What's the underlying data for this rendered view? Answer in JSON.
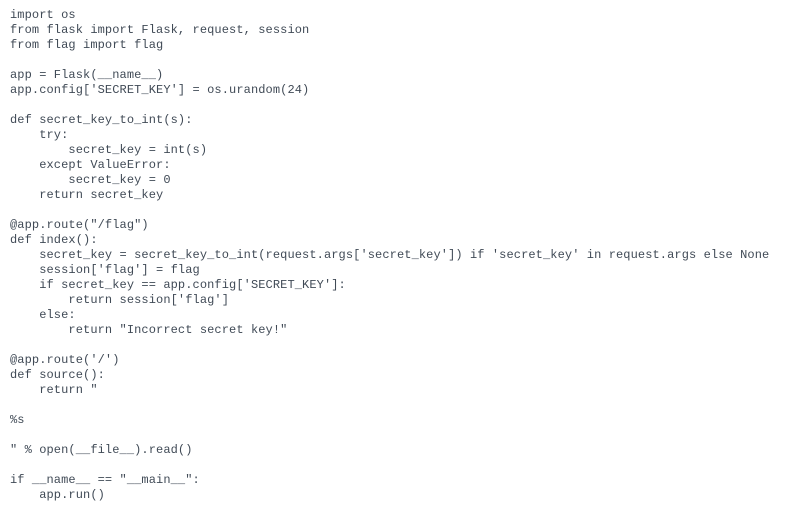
{
  "code": {
    "lines": [
      "import os",
      "from flask import Flask, request, session",
      "from flag import flag",
      "",
      "app = Flask(__name__)",
      "app.config['SECRET_KEY'] = os.urandom(24)",
      "",
      "def secret_key_to_int(s):",
      "    try:",
      "        secret_key = int(s)",
      "    except ValueError:",
      "        secret_key = 0",
      "    return secret_key",
      "",
      "@app.route(\"/flag\")",
      "def index():",
      "    secret_key = secret_key_to_int(request.args['secret_key']) if 'secret_key' in request.args else None",
      "    session['flag'] = flag",
      "    if secret_key == app.config['SECRET_KEY']:",
      "        return session['flag']",
      "    else:",
      "        return \"Incorrect secret key!\"",
      "",
      "@app.route('/')",
      "def source():",
      "    return \"",
      "",
      "%s",
      "",
      "\" % open(__file__).read()",
      "",
      "if __name__ == \"__main__\":",
      "    app.run()"
    ]
  }
}
